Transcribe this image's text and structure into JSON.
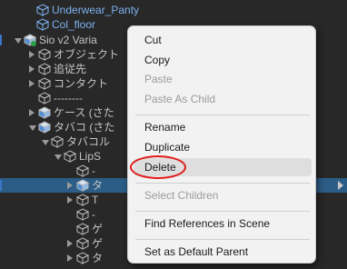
{
  "colors": {
    "background": "#282828",
    "selection": "#2c5d87",
    "prefab_text": "#7cb0ee",
    "text": "#c4c4c4",
    "menu_bg": "#f2f2f2",
    "annotation": "#e11a1a"
  },
  "hierarchy": {
    "rows": [
      {
        "label": "Underwear_Panty",
        "type": "prefab",
        "icon": "cube-outline-icon"
      },
      {
        "label": "Col_floor",
        "type": "prefab",
        "icon": "cube-outline-icon"
      },
      {
        "label": "Sio v2 Varia",
        "type": "normal",
        "icon": "avatar-cube-icon",
        "expanded": true
      },
      {
        "label": "オブジェクト",
        "type": "normal",
        "icon": "cube-outline-icon"
      },
      {
        "label": "追従先",
        "type": "normal",
        "icon": "cube-outline-icon"
      },
      {
        "label": "コンタクト",
        "type": "normal",
        "icon": "cube-outline-icon"
      },
      {
        "label": "--------",
        "type": "normal",
        "icon": "cube-outline-icon"
      },
      {
        "label": "ケース (さた",
        "type": "normal",
        "icon": "cube-filled-icon"
      },
      {
        "label": "タバコ (さた",
        "type": "normal",
        "icon": "cube-filled-icon",
        "expanded": true
      },
      {
        "label": "タバコル",
        "type": "normal",
        "icon": "cube-outline-icon",
        "expanded": true
      },
      {
        "label": "LipS",
        "type": "normal",
        "icon": "cube-outline-icon",
        "expanded": true
      },
      {
        "label": "-",
        "type": "normal",
        "icon": "cube-outline-icon"
      },
      {
        "label": "タ",
        "type": "normal",
        "icon": "cube-filled-icon",
        "selected": true
      },
      {
        "label": "T",
        "type": "normal",
        "icon": "cube-outline-icon"
      },
      {
        "label": "-",
        "type": "normal",
        "icon": "cube-outline-icon"
      },
      {
        "label": "ゲ",
        "type": "normal",
        "icon": "cube-outline-icon"
      },
      {
        "label": "ゲ",
        "type": "normal",
        "icon": "cube-outline-icon"
      },
      {
        "label": "タ",
        "type": "normal",
        "icon": "cube-outline-icon"
      }
    ]
  },
  "context_menu": {
    "items": [
      {
        "label": "Cut",
        "enabled": true
      },
      {
        "label": "Copy",
        "enabled": true
      },
      {
        "label": "Paste",
        "enabled": false
      },
      {
        "label": "Paste As Child",
        "enabled": false
      },
      {
        "separator": true
      },
      {
        "label": "Rename",
        "enabled": true
      },
      {
        "label": "Duplicate",
        "enabled": true
      },
      {
        "label": "Delete",
        "enabled": true,
        "hovered": true
      },
      {
        "separator": true
      },
      {
        "label": "Select Children",
        "enabled": false
      },
      {
        "separator": true
      },
      {
        "label": "Find References in Scene",
        "enabled": true
      },
      {
        "separator": true
      },
      {
        "label": "Set as Default Parent",
        "enabled": true
      }
    ]
  }
}
